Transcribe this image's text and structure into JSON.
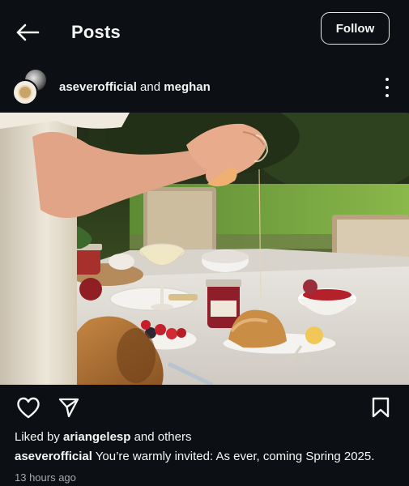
{
  "header": {
    "title": "Posts",
    "follow_label": "Follow",
    "back_icon": "arrow-left-icon"
  },
  "post": {
    "author_primary": "aseverofficial",
    "author_joiner": " and ",
    "author_secondary": "meghan",
    "more_icon": "more-vertical-icon",
    "image_description_icon": "post-photo",
    "likes_prefix": "Liked by ",
    "likes_user": "ariangelesp",
    "likes_suffix": " and others",
    "caption_user": "aseverofficial",
    "caption_text": " You’re warmly invited: As ever, coming Spring 2025.",
    "timestamp": "13 hours ago"
  },
  "icons": {
    "like": "heart-icon",
    "share": "send-icon",
    "save": "bookmark-icon"
  },
  "colors": {
    "background": "#0c1014",
    "text": "#f5f5f5",
    "muted": "#a8a8a8"
  }
}
